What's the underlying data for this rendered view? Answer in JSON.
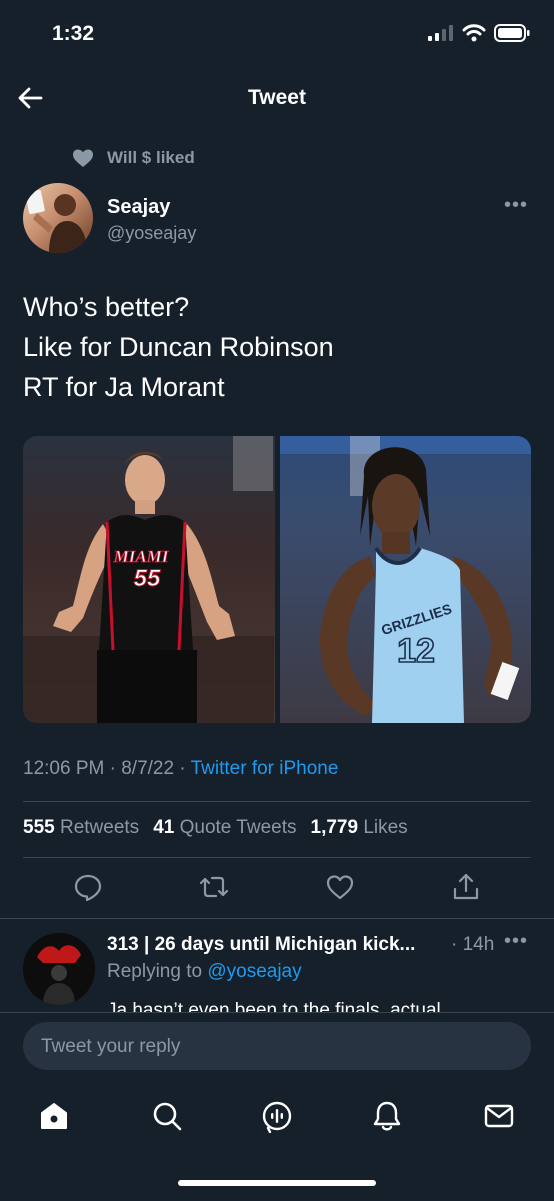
{
  "status_bar": {
    "time": "1:32"
  },
  "header": {
    "title": "Tweet"
  },
  "social_context": {
    "text": "Will $ liked"
  },
  "author": {
    "name": "Seajay",
    "handle": "@yoseajay"
  },
  "tweet": {
    "lines": [
      "Who’s better?",
      "Like for Duncan Robinson",
      "RT for Ja Morant"
    ],
    "media": [
      {
        "jersey_team": "MIAMI",
        "jersey_number": "55"
      },
      {
        "jersey_team": "GRIZZLIES",
        "jersey_number": "12"
      }
    ],
    "time": "12:06 PM",
    "date": "8/7/22",
    "source": "Twitter for iPhone"
  },
  "stats": {
    "retweets_count": "555",
    "retweets_label": "Retweets",
    "quotes_count": "41",
    "quotes_label": "Quote Tweets",
    "likes_count": "1,779",
    "likes_label": "Likes"
  },
  "reply": {
    "name": "313 | 26 days until Michigan kick...",
    "time": "· 14h",
    "replying_to_label": "Replying to",
    "replying_to_handle": "@yoseajay",
    "snippet": "Ja hasn’t even been to the finals, actual"
  },
  "composer": {
    "placeholder": "Tweet your reply"
  },
  "colors": {
    "background": "#15202b",
    "accent": "#1d9bf0",
    "muted": "#8b98a5",
    "divider": "#38444d"
  },
  "icons": [
    "back-arrow-icon",
    "heart-icon",
    "more-icon",
    "reply-icon",
    "retweet-icon",
    "like-icon",
    "share-icon",
    "home-icon",
    "search-icon",
    "spaces-icon",
    "notifications-icon",
    "messages-icon"
  ]
}
